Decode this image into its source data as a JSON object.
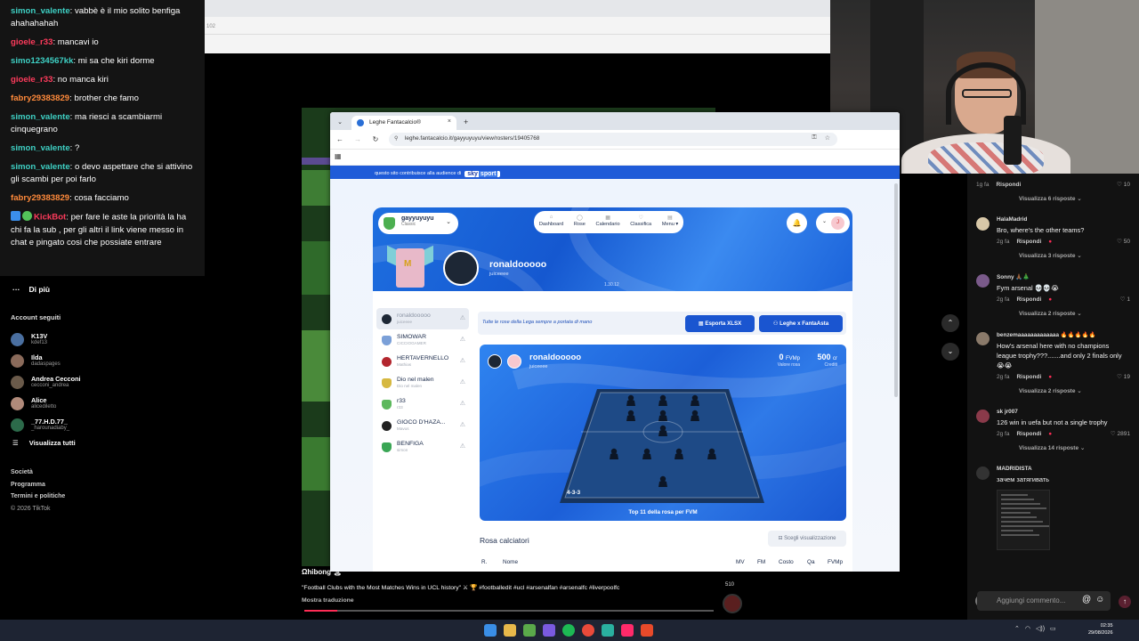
{
  "chat": {
    "messages": [
      {
        "user": "simon_valente",
        "color": "#3ed0c4",
        "text": ": vabbè è il mio solito benfiga ahahahahah"
      },
      {
        "user": "gioele_r33",
        "color": "#ff3b5c",
        "text": ": mancavi io"
      },
      {
        "user": "simo1234567kk",
        "color": "#3ed0c4",
        "text": ": mi sa che kiri dorme"
      },
      {
        "user": "gioele_r33",
        "color": "#ff3b5c",
        "text": ": no manca kiri"
      },
      {
        "user": "fabry29383829",
        "color": "#ff8a3b",
        "text": ": brother che famo"
      },
      {
        "user": "simon_valente",
        "color": "#3ed0c4",
        "text": ": ma riesci a scambiarmi cinquegrano"
      },
      {
        "user": "simon_valente",
        "color": "#3ed0c4",
        "text": ": ?"
      },
      {
        "user": "simon_valente",
        "color": "#3ed0c4",
        "text": ": o devo aspettare che si attivino gli scambi per poi farlo"
      },
      {
        "user": "fabry29383829",
        "color": "#ff8a3b",
        "text": ": cosa facciamo"
      },
      {
        "user": "KickBot",
        "color": "#ff3b5c",
        "text": ": per fare le aste la priorità la ha chi fa la sub , per gli altri il link viene messo in chat e pingato cosi che possiate entrare",
        "bot": true
      }
    ]
  },
  "tiktok_left": {
    "more": "Di più",
    "section": "Account seguiti",
    "accounts": [
      {
        "name": "K13V",
        "handle": "kdef13",
        "color": "#4a6fa0"
      },
      {
        "name": "Ilda",
        "handle": "dadaspages",
        "color": "#8a6a5a"
      },
      {
        "name": "Andrea Cecconi",
        "handle": "cecconi_andrea",
        "color": "#6a5a4a"
      },
      {
        "name": "Alice",
        "handle": "alicediletto",
        "color": "#b08a7a"
      },
      {
        "name": "_77.H.D.77_",
        "handle": "_harounadiaby_",
        "color": "#2c6a4a"
      }
    ],
    "view_all": "Visualizza tutti",
    "footer": [
      "Società",
      "Programma",
      "Termini e politiche",
      "© 2026 TikTok"
    ]
  },
  "bg_window": {
    "row_text": "102"
  },
  "browser": {
    "tab_title": "Leghe Fantacalcio®",
    "url": "leghe.fantacalcio.it/gayyuyuyu/view/rosters/19405768",
    "sky_text": "questo sito contribuisce alla audience di",
    "sky_logo": "sky",
    "sky_logo2": "sport"
  },
  "league": {
    "name": "gayyuyuyu",
    "sub": "Classic",
    "nav": [
      {
        "label": "Dashboard",
        "icon": "⌂"
      },
      {
        "label": "Rose",
        "icon": "◯"
      },
      {
        "label": "Calendario",
        "icon": "▦"
      },
      {
        "label": "Classifica",
        "icon": "♡"
      },
      {
        "label": "Menu ▾",
        "icon": "▤"
      }
    ],
    "user_initial": "J",
    "team_name": "ronaldooooo",
    "team_sub": "juiceeee",
    "version": "1.30.12"
  },
  "teams": [
    {
      "name": "ronaldooooo",
      "sub": "juiceeee",
      "icon_color": "#1d2735",
      "active": true
    },
    {
      "name": "SIMOWAR",
      "sub": "CICCIOGAMER",
      "icon_color": "#7ba0d8",
      "active": false
    },
    {
      "name": "HERTAVERNELLO",
      "sub": "Mathias",
      "icon_color": "#b3262e",
      "active": false
    },
    {
      "name": "Dio nel malen",
      "sub": "Dio nel malen",
      "icon_color": "#d6b840",
      "active": false
    },
    {
      "name": "r33",
      "sub": "r33",
      "icon_color": "#5cb85c",
      "active": false
    },
    {
      "name": "GIOCO D'HAZA...",
      "sub": "Mavus",
      "icon_color": "#222",
      "active": false
    },
    {
      "name": "BENFIGA",
      "sub": "simon",
      "icon_color": "#3aa655",
      "active": false
    }
  ],
  "roster_panel": {
    "info": "Tutte le rose della Lega sempre a portata di mano",
    "export_btn": "Esporta XLSX",
    "fantaasta_btn": "Leghe x FantaAsta",
    "card_name": "ronaldooooo",
    "card_sub": "juiceeee",
    "fvmp_value": "0",
    "fvmp_unit": "FVMp",
    "fvmp_label": "Valore rosa",
    "credits_value": "500",
    "credits_unit": "cr",
    "credits_label": "Crediti",
    "module": "4-3-3",
    "footer": "Top 11 della rosa per FVM",
    "rosa_title": "Rosa calciatori",
    "rosa_btn": "Scegli visualizzazione",
    "columns": [
      "R.",
      "Nome",
      "MV",
      "FM",
      "Costo",
      "Qa",
      "FVMp"
    ]
  },
  "tiktok_caption": {
    "user": "Ωhibong 🏝",
    "text": "\"Football Clubs with the Most Matches Wins in UCL history\" ⚔ 🏆 #footballedit #ucl #arsenalfan #arsenalfc #liverpoolfc",
    "translate": "Mostra traduzione",
    "count": "510",
    "progress": 0.08
  },
  "comments": {
    "top_meta": {
      "time": "1g fa",
      "reply": "Rispondi",
      "likes": "10"
    },
    "top_view": "Visualizza 6 risposte ⌄",
    "items": [
      {
        "user": "HalaMadrid",
        "text": "Bro, where's the other teams?",
        "time": "2g fa",
        "reply": "Rispondi",
        "likes": "50",
        "view": "Visualizza 3 risposte ⌄",
        "color": "#d8c8a8"
      },
      {
        "user": "Sonny 🙏🏾🎄",
        "text": "Fym arsenal 💀💀😭",
        "time": "2g fa",
        "reply": "Rispondi",
        "likes": "1",
        "view": "Visualizza 2 risposte ⌄",
        "color": "#7a5a8a"
      },
      {
        "user": "benzemaaaaaaaaaaaaa 🔥🔥🔥🔥🔥",
        "text": "How's arsenal here with no champions league trophy???.......and only 2 finals only 😭😭",
        "time": "2g fa",
        "reply": "Rispondi",
        "likes": "19",
        "view": "Visualizza 2 risposte ⌄",
        "color": "#8a7a6a"
      },
      {
        "user": "sk jr007",
        "text": "126 win in uefa but not a single trophy",
        "time": "2g fa",
        "reply": "Rispondi",
        "likes": "2891",
        "view": "Visualizza 14 risposte ⌄",
        "color": "#8a3a4a"
      },
      {
        "user": "MADRIDISTA",
        "text": "зачем затягивать",
        "color": "#333"
      }
    ],
    "input_placeholder": "Aggiungi commento..."
  },
  "taskbar": {
    "time": "02:35",
    "date": "29/08/2026",
    "icon_colors": [
      "#3a8ee6",
      "#e8b84a",
      "#5aa94a",
      "#7a5ae0",
      "#1db954",
      "#e94a3a",
      "#2ab0a0",
      "#ff2a6a",
      "#e84a2a"
    ]
  }
}
